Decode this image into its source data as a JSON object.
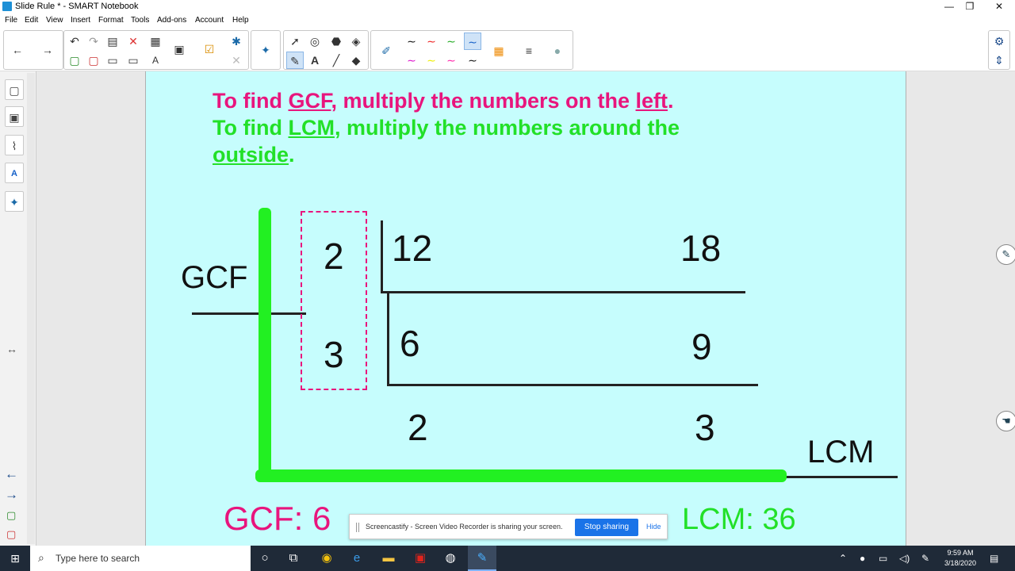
{
  "window": {
    "title": "Slide Rule * - SMART Notebook",
    "minimize_glyph": "—",
    "restore_glyph": "❐",
    "close_glyph": "✕"
  },
  "menu": [
    "File",
    "Edit",
    "View",
    "Insert",
    "Format",
    "Tools",
    "Add-ons",
    "Account",
    "Help"
  ],
  "slide": {
    "heading_pink_pre": "To find ",
    "heading_pink_term": "GCF",
    "heading_pink_mid": ", multiply the numbers on the ",
    "heading_pink_word": "left",
    "heading_pink_end": ".",
    "heading_green_pre": "To find ",
    "heading_green_term": "LCM",
    "heading_green_mid": ", multiply the numbers around the",
    "heading_green_word": "outside",
    "heading_green_end": ".",
    "gcf_label": "GCF",
    "lcm_label": "LCM",
    "divisor_top": "2",
    "divisor_bottom": "3",
    "row1_left": "12",
    "row1_right": "18",
    "row2_left": "6",
    "row2_right": "9",
    "row3_left": "2",
    "row3_right": "3",
    "gcf_result": "GCF:  6",
    "lcm_result": "LCM:  36"
  },
  "banner": {
    "message": "Screencastify - Screen Video Recorder is sharing your screen.",
    "stop_label": "Stop sharing",
    "hide_label": "Hide"
  },
  "taskbar": {
    "search_placeholder": "Type here to search",
    "time": "9:59 AM",
    "date": "3/18/2020"
  },
  "colors": {
    "pink": "#e8157d",
    "green": "#22e028",
    "slide_bg": "#c6fdfd",
    "taskbar_bg": "#1f2a38"
  }
}
